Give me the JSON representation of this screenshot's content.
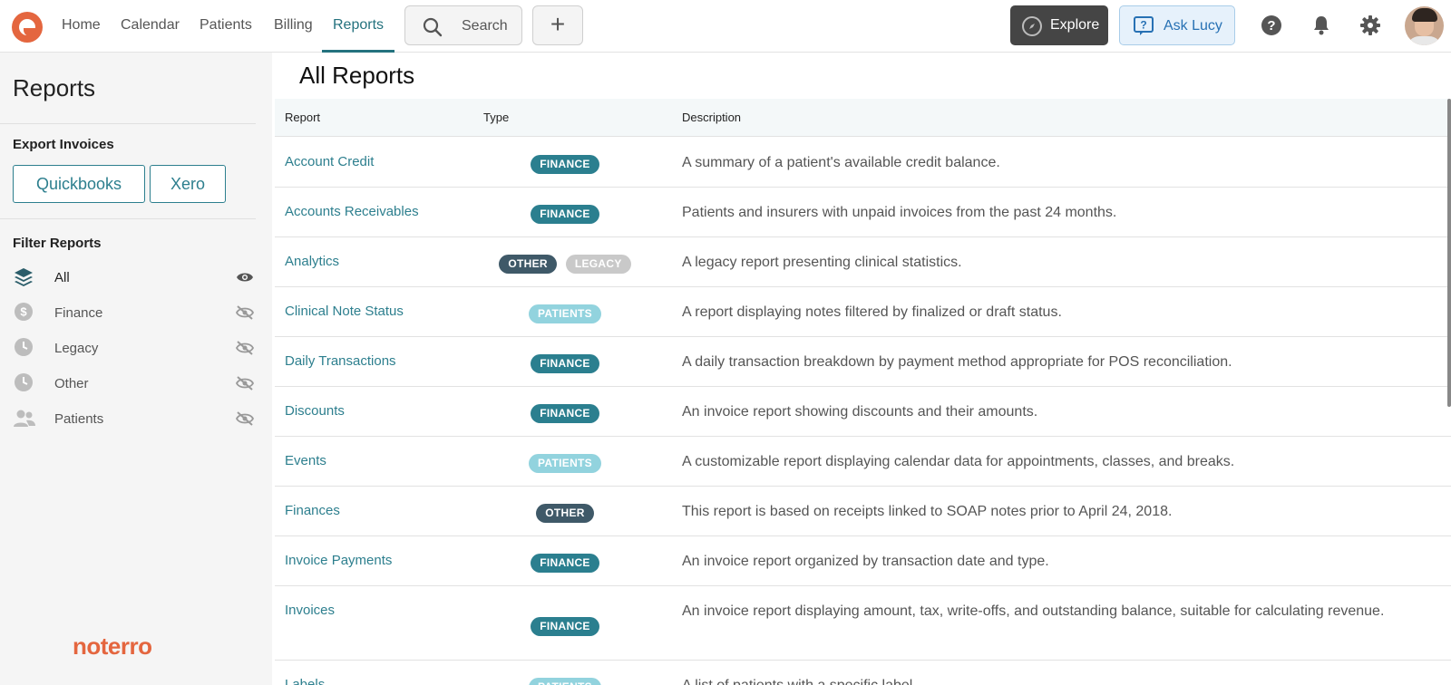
{
  "nav": {
    "links": [
      "Home",
      "Calendar",
      "Patients",
      "Billing",
      "Reports"
    ],
    "active": "Reports",
    "search_label": "Search",
    "add_label": "+",
    "explore_label": "Explore",
    "ask_label": "Ask Lucy"
  },
  "sidebar": {
    "title": "Reports",
    "export_heading": "Export Invoices",
    "export_buttons": [
      "Quickbooks",
      "Xero"
    ],
    "filter_heading": "Filter Reports",
    "filters": [
      {
        "label": "All",
        "icon": "layers-icon",
        "visible": true
      },
      {
        "label": "Finance",
        "icon": "dollar-icon",
        "visible": false
      },
      {
        "label": "Legacy",
        "icon": "clock-icon",
        "visible": false
      },
      {
        "label": "Other",
        "icon": "clock-icon",
        "visible": false
      },
      {
        "label": "Patients",
        "icon": "people-icon",
        "visible": false
      }
    ],
    "brand": "noterro"
  },
  "main": {
    "title": "All Reports",
    "columns": [
      "Report",
      "Type",
      "Description"
    ],
    "rows": [
      {
        "name": "Account Credit",
        "types": [
          "FINANCE"
        ],
        "description": "A summary of a patient's available credit balance."
      },
      {
        "name": "Accounts Receivables",
        "types": [
          "FINANCE"
        ],
        "description": "Patients and insurers with unpaid invoices from the past 24 months."
      },
      {
        "name": "Analytics",
        "types": [
          "OTHER",
          "LEGACY"
        ],
        "description": "A legacy report presenting clinical statistics."
      },
      {
        "name": "Clinical Note Status",
        "types": [
          "PATIENTS"
        ],
        "description": "A report displaying notes filtered by finalized or draft status."
      },
      {
        "name": "Daily Transactions",
        "types": [
          "FINANCE"
        ],
        "description": "A daily transaction breakdown by payment method appropriate for POS reconciliation."
      },
      {
        "name": "Discounts",
        "types": [
          "FINANCE"
        ],
        "description": "An invoice report showing discounts and their amounts."
      },
      {
        "name": "Events",
        "types": [
          "PATIENTS"
        ],
        "description": "A customizable report displaying calendar data for appointments, classes, and breaks."
      },
      {
        "name": "Finances",
        "types": [
          "OTHER"
        ],
        "description": "This report is based on receipts linked to SOAP notes prior to April 24, 2018."
      },
      {
        "name": "Invoice Payments",
        "types": [
          "FINANCE"
        ],
        "description": "An invoice report organized by transaction date and type."
      },
      {
        "name": "Invoices",
        "types": [
          "FINANCE"
        ],
        "description": "An invoice report displaying amount, tax, write-offs, and outstanding balance, suitable for calculating revenue."
      },
      {
        "name": "Labels",
        "types": [
          "PATIENTS"
        ],
        "description": "A list of patients with a specific label."
      }
    ]
  },
  "colors": {
    "accent": "#2d7f8e",
    "brand": "#e4663f",
    "finance": "#2b7f8f",
    "patients": "#92d3de",
    "other": "#3f5968",
    "legacy": "#c9c9c9"
  }
}
